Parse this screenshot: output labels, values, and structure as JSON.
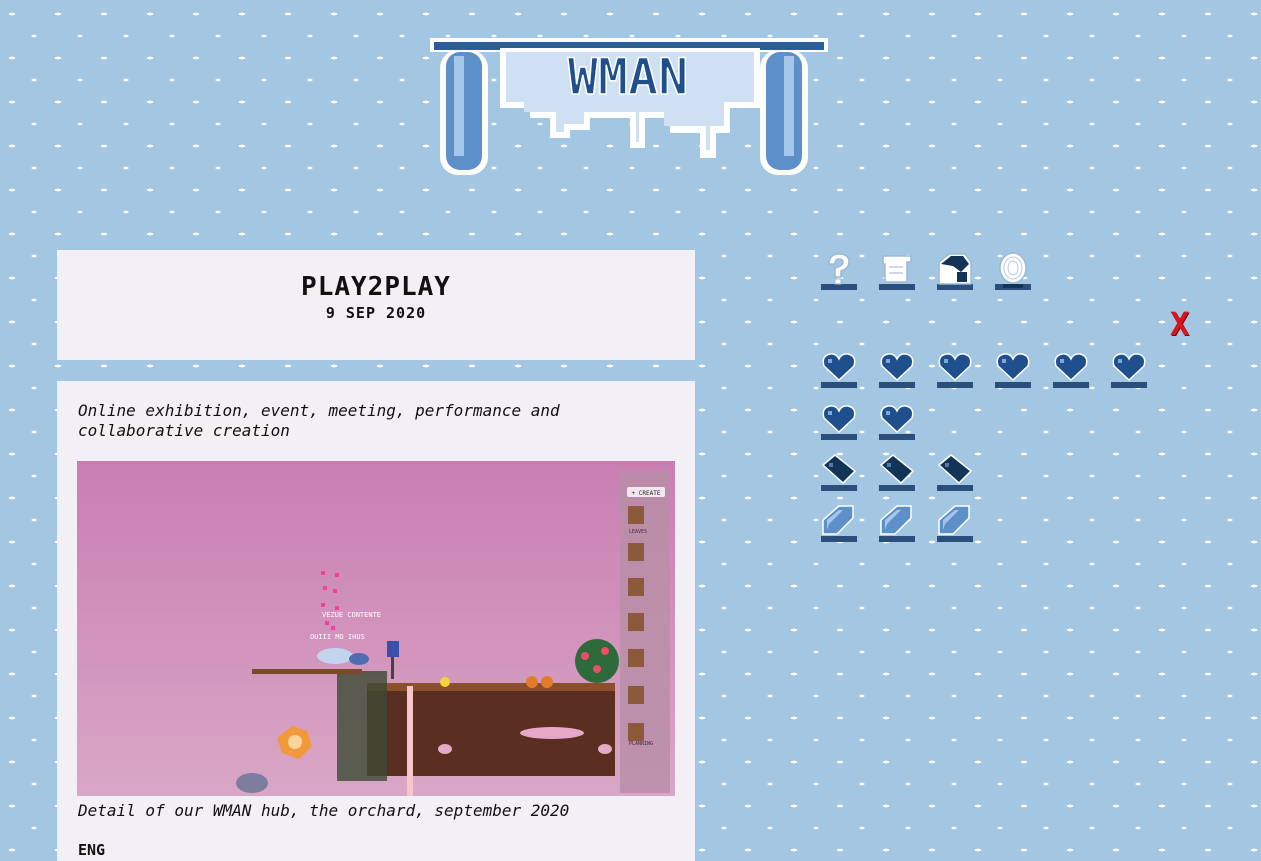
{
  "site": {
    "logo_text": "WMAN"
  },
  "post": {
    "title": "PLAY2PLAY",
    "date": "9 SEP 2020",
    "intro": "Online exhibition, event, meeting, performance and collaborative creation",
    "caption": "Detail of our WMAN hub, the orchard, september 2020",
    "language_label": "ENG"
  },
  "screenshot": {
    "create_button": "+ CREATE",
    "item_label": "LEAVES",
    "planning_label": "PLANNING",
    "chat_line_1": "VEZUE CONTENTE",
    "chat_line_2": "OUIII MO IHUS"
  },
  "nav_icons": [
    "question-icon",
    "scroll-icon",
    "cow-icon",
    "fingerprint-icon"
  ],
  "close_label": "X",
  "colors": {
    "background": "#a3c6e3",
    "panel": "#f3f0f5",
    "accent_blue": "#1f4f8c",
    "close_red": "#d8141c"
  }
}
